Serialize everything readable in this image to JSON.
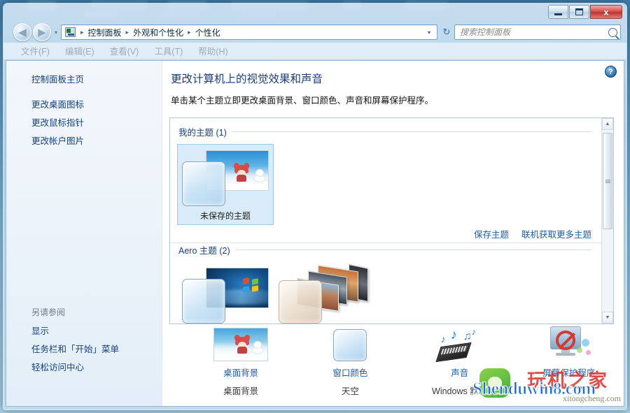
{
  "window": {
    "controls": {
      "minimize": "–",
      "maximize": "▫",
      "close": "x"
    }
  },
  "addressbar": {
    "back_arrow": "◀",
    "forward_arrow": "▶",
    "history_caret": "▾",
    "crumbs": [
      "控制面板",
      "外观和个性化",
      "个性化"
    ],
    "separator": "▸",
    "dropdown_caret": "▾",
    "refresh": "↻"
  },
  "search": {
    "placeholder": "搜索控制面板",
    "value": ""
  },
  "menubar": {
    "items": [
      "文件(F)",
      "编辑(E)",
      "查看(V)",
      "工具(T)",
      "帮助(H)"
    ]
  },
  "sidebar": {
    "home": "控制面板主页",
    "links": [
      "更改桌面图标",
      "更改鼠标指针",
      "更改帐户图片"
    ],
    "see_also_title": "另请参阅",
    "see_also": [
      "显示",
      "任务栏和「开始」菜单",
      "轻松访问中心"
    ]
  },
  "content": {
    "help_glyph": "?",
    "title": "更改计算机上的视觉效果和声音",
    "subtitle": "单击某个主题立即更改桌面背景、窗口颜色、声音和屏幕保护程序。",
    "groups": [
      {
        "name": "我的主题 (1)",
        "themes": [
          {
            "label": "未保存的主题",
            "selected": true
          }
        ]
      },
      {
        "name": "Aero 主题 (2)",
        "themes": [
          {
            "label": "",
            "selected": false
          },
          {
            "label": "",
            "selected": false
          }
        ]
      }
    ],
    "links": [
      "保存主题",
      "联机获取更多主题"
    ]
  },
  "settings": [
    {
      "name": "桌面背景",
      "value": "桌面背景",
      "icon": "desktop-background-icon"
    },
    {
      "name": "窗口颜色",
      "value": "天空",
      "icon": "window-color-icon"
    },
    {
      "name": "声音",
      "value": "Windows 默认",
      "icon": "sound-icon"
    },
    {
      "name": "屏幕保护程序",
      "value": "",
      "icon": "screensaver-icon"
    }
  ],
  "watermark": {
    "main": "Shenduwin8.com",
    "cn": "玩机之家",
    "sub": "xitongcheng.com"
  },
  "scrollbar": {
    "up": "▲",
    "down": "▼"
  },
  "colors": {
    "link": "#1a5fa8",
    "title": "#1a3e77",
    "accent": "#2e7fd4"
  }
}
